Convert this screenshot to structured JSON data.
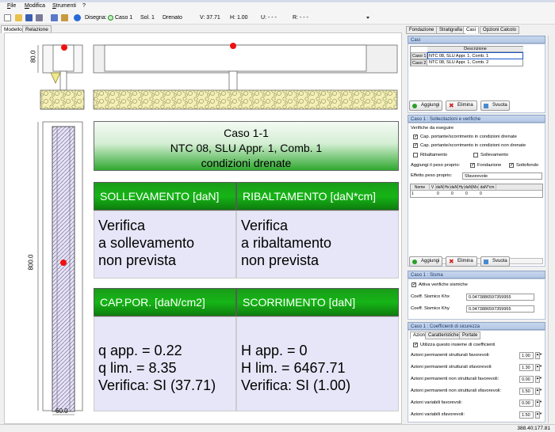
{
  "menu": {
    "file": "File",
    "modifica": "Modifica",
    "strumenti": "Strumenti",
    "help": "?"
  },
  "toolbar": {
    "disegna": "Disegna:",
    "caso": "Caso 1",
    "sol": "Sol. 1",
    "drenato": "Drenato",
    "v": "V: 37.71",
    "h": "H: 1.00",
    "u": "U: - - -",
    "r": "R: - - -"
  },
  "left_tabs": {
    "modello": "Modello",
    "relazione": "Relazione"
  },
  "drawing": {
    "dim_top": "80.0",
    "dim_left": "800.0",
    "dim_bottom": "60.0"
  },
  "report": {
    "title1": "Caso 1-1",
    "title2": "NTC 08, SLU Appr. 1, Comb. 1",
    "title3": "condizioni drenate",
    "h_soll": "SOLLEVAMENTO [daN]",
    "h_rib": "RIBALTAMENTO [daN*cm]",
    "soll1": "Verifica",
    "soll2": "a sollevamento",
    "soll3": "non prevista",
    "rib1": "Verifica",
    "rib2": "a ribaltamento",
    "rib3": "non prevista",
    "h_cap": "CAP.POR. [daN/cm2]",
    "h_scorr": "SCORRIMENTO [daN]",
    "cap1": "q app. = 0.22",
    "cap2": "q lim. = 8.35",
    "cap3": "Verifica: SI (37.71)",
    "sc1": "H app. = 0",
    "sc2": "H lim. = 6467.71",
    "sc3": "Verifica: SI (1.00)"
  },
  "right_tabs": {
    "fondazione": "Fondazione",
    "stratigrafia": "Stratigrafia",
    "casi": "Casi",
    "opzioni": "Opzioni Calcolo"
  },
  "casi": {
    "head": "Casi",
    "col": "Descrizione",
    "r1_id": "Caso 1",
    "r1_desc": "NTC 08, SLU Appr. 1, Comb. 1",
    "r2_id": "Caso 2",
    "r2_desc": "NTC 08, SLU Appr. 1, Comb. 2",
    "aggiungi": "Aggiungi",
    "elimina": "Elimina",
    "svuota": "Svuota"
  },
  "soll": {
    "head": "Caso 1 : Sollecitazioni e verifiche",
    "verifiche": "Verifiche da eseguire",
    "c1": "Cap. portante/scorrimento in condizioni drenate",
    "c2": "Cap. portante/scorrimento in condizioni non drenate",
    "rib": "Ribaltamento",
    "sol": "Sollevamento",
    "peso": "Aggiungi il peso proprio:",
    "fond": "Fondazione",
    "sotto": "Sottofondo",
    "effetto": "Effetto peso proprio:",
    "effetto_val": "Sfavorevole",
    "th": [
      "Nome",
      "V",
      "daN",
      "Hx",
      "daN",
      "Hy",
      "daN",
      "Mx",
      "daN*cm"
    ],
    "row": [
      "1",
      "",
      "0",
      "",
      "0",
      "",
      "0",
      "",
      "0"
    ],
    "aggiungi": "Aggiungi",
    "elimina": "Elimina",
    "svuota": "Svuota"
  },
  "sisma": {
    "head": "Caso 1 : Sisma",
    "attiva": "Attiva verifiche sismiche",
    "khx_l": "Coeff. Sismico Khx",
    "khx": "0.0473886597359955",
    "khy_l": "Coeff. Sismico Khy",
    "khy": "0.0473886597359955"
  },
  "coeff": {
    "head": "Caso 1 : Coefficienti di sicurezza",
    "t1": "Azioni",
    "t2": "Caratteristiche",
    "t3": "Portate",
    "usa": "Utilizza questo insieme di coefficienti",
    "r": [
      {
        "l": "Azioni permanenti strutturali favorevoli:",
        "v": "1.00"
      },
      {
        "l": "Azioni permanenti strutturali sfavorevoli:",
        "v": "1.30"
      },
      {
        "l": "Azioni permanenti non strutturali favorevoli:",
        "v": "0.00"
      },
      {
        "l": "Azioni permanenti non strutturali sfavorevoli:",
        "v": "1.50"
      },
      {
        "l": "Azioni variabili favorevoli:",
        "v": "0.00"
      },
      {
        "l": "Azioni variabili sfavorevoli:",
        "v": "1.50"
      }
    ]
  },
  "status": {
    "coords": "388.40;177.81"
  }
}
